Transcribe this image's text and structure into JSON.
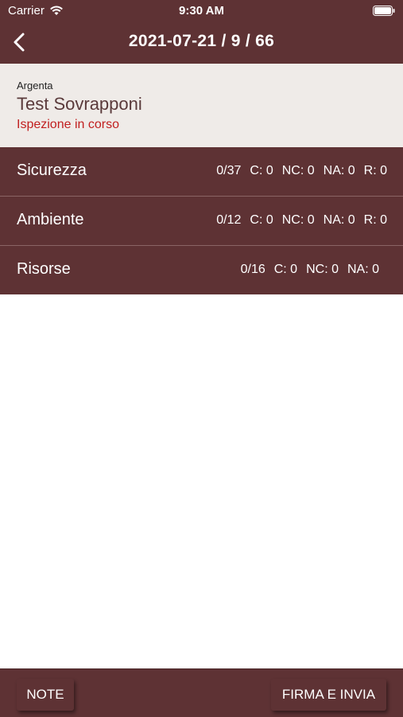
{
  "status_bar": {
    "carrier": "Carrier",
    "time": "9:30 AM"
  },
  "nav": {
    "title": "2021-07-21 / 9 / 66",
    "back_icon": "chevron-left-icon"
  },
  "inspection": {
    "client": "Argenta",
    "name": "Test Sovrapponi",
    "status": "Ispezione in corso"
  },
  "sections": [
    {
      "label": "Sicurezza",
      "stats": [
        "0/37",
        "C: 0",
        "NC: 0",
        "NA: 0",
        "R: 0"
      ]
    },
    {
      "label": "Ambiente",
      "stats": [
        "0/12",
        "C: 0",
        "NC: 0",
        "NA: 0",
        "R: 0"
      ]
    },
    {
      "label": "Risorse",
      "stats": [
        "0/16",
        "C: 0",
        "NC: 0",
        "NA: 0"
      ]
    }
  ],
  "buttons": {
    "note": "NOTE",
    "sign_send": "FIRMA E INVIA"
  },
  "colors": {
    "brand": "#5e3234",
    "info_bg": "#efebe8",
    "status_red": "#c11f1f"
  }
}
